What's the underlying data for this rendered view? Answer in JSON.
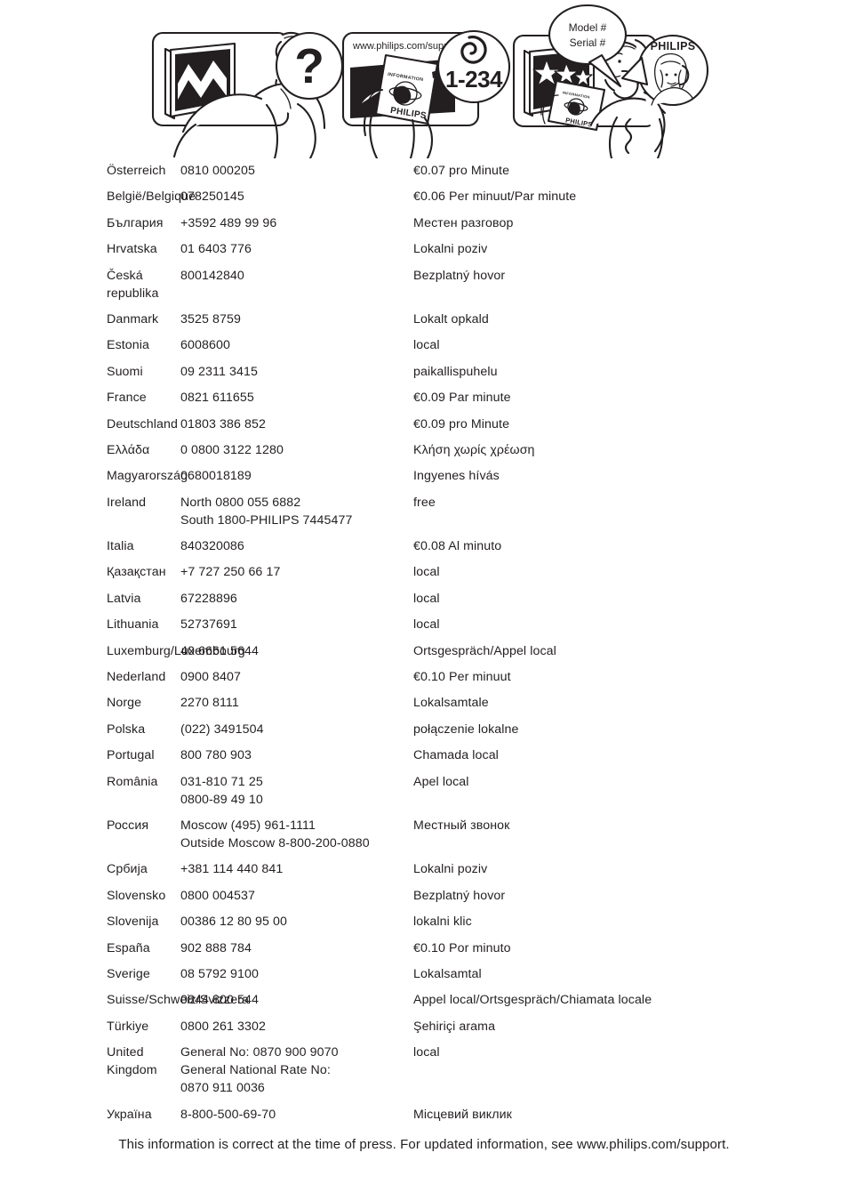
{
  "illustration": {
    "panel1": {
      "name": "confused-viewer-panel",
      "question_mark": "?"
    },
    "panel2": {
      "name": "support-website-panel",
      "website": "www.philips.com/support",
      "phone_badge": "1-234",
      "leaflet_title": "INFORMATION",
      "leaflet_brand": "PHILIPS"
    },
    "panel3": {
      "name": "call-support-panel",
      "speech_line1": "Model #",
      "speech_line2": "Serial #",
      "agent_brand": "PHILIPS",
      "leaflet_brand": "PHILIPS"
    }
  },
  "table": {
    "rows": [
      {
        "country": "Österreich",
        "number": "0810 000205",
        "rate": "€0.07 pro Minute"
      },
      {
        "country": "België/Belgique",
        "number": "078250145",
        "rate": "€0.06 Per minuut/Par minute"
      },
      {
        "country": "България",
        "number": "+3592 489 99 96",
        "rate": "Местен разговор"
      },
      {
        "country": "Hrvatska",
        "number": "01 6403 776",
        "rate": "Lokalni poziv"
      },
      {
        "country": "Česká republika",
        "number": "800142840",
        "rate": "Bezplatný hovor"
      },
      {
        "country": "Danmark",
        "number": "3525 8759",
        "rate": "Lokalt opkald"
      },
      {
        "country": "Estonia",
        "number": "6008600",
        "rate": "local"
      },
      {
        "country": "Suomi",
        "number": "09 2311 3415",
        "rate": "paikallispuhelu"
      },
      {
        "country": "France",
        "number": "0821 611655",
        "rate": "€0.09 Par minute"
      },
      {
        "country": "Deutschland",
        "number": "01803 386 852",
        "rate": "€0.09 pro Minute"
      },
      {
        "country": "Ελλάδα",
        "number": "0 0800 3122 1280",
        "rate": "Κλήση χωρίς χρέωση"
      },
      {
        "country": "Magyarország",
        "number": "0680018189",
        "rate": "Ingyenes hívás"
      },
      {
        "country": "Ireland",
        "number": "North 0800 055 6882\nSouth 1800-PHILIPS 7445477",
        "rate": "free"
      },
      {
        "country": "Italia",
        "number": "840320086",
        "rate": "€0.08 Al minuto"
      },
      {
        "country": "Қазақстан",
        "number": "+7 727 250 66 17",
        "rate": "local"
      },
      {
        "country": "Latvia",
        "number": "67228896",
        "rate": "local"
      },
      {
        "country": "Lithuania",
        "number": "52737691",
        "rate": "local"
      },
      {
        "country": "Luxemburg/Luxembourg",
        "number": "40 6661 5644",
        "rate": "Ortsgespräch/Appel local"
      },
      {
        "country": "Nederland",
        "number": "0900 8407",
        "rate": "€0.10 Per minuut"
      },
      {
        "country": "Norge",
        "number": "2270 8111",
        "rate": "Lokalsamtale"
      },
      {
        "country": "Polska",
        "number": "(022) 3491504",
        "rate": "połączenie lokalne"
      },
      {
        "country": "Portugal",
        "number": "800 780 903",
        "rate": "Chamada local"
      },
      {
        "country": "România",
        "number": "031-810 71 25\n0800-89 49 10",
        "rate": "Apel local"
      },
      {
        "country": "Россия",
        "number": "Moscow (495) 961-1111\nOutside Moscow 8-800-200-0880",
        "rate": "Местный звонок"
      },
      {
        "country": "Србија",
        "number": "+381 114 440 841",
        "rate": "Lokalni poziv"
      },
      {
        "country": "Slovensko",
        "number": "0800 004537",
        "rate": "Bezplatný hovor"
      },
      {
        "country": "Slovenija",
        "number": "00386 12 80 95 00",
        "rate": "lokalni klic"
      },
      {
        "country": "España",
        "number": "902 888 784",
        "rate": "€0.10 Por minuto"
      },
      {
        "country": "Sverige",
        "number": "08 5792 9100",
        "rate": "Lokalsamtal"
      },
      {
        "country": "Suisse/Schweiz/Svizzera",
        "number": "0844 800 544",
        "rate": "Appel local/Ortsgespräch/Chiamata locale"
      },
      {
        "country": "Türkiye",
        "number": "0800 261 3302",
        "rate": "Şehiriçi arama"
      },
      {
        "country": "United Kingdom",
        "number": "General No: 0870 900 9070\nGeneral National Rate No:\n0870 911 0036",
        "rate": "local"
      },
      {
        "country": "Україна",
        "number": "8-800-500-69-70",
        "rate": "Місцевий виклик"
      }
    ]
  },
  "footer": {
    "note": "This information is correct at the time of press. For updated information, see www.philips.com/support."
  },
  "colors": {
    "ink": "#231f20",
    "paper": "#ffffff"
  }
}
